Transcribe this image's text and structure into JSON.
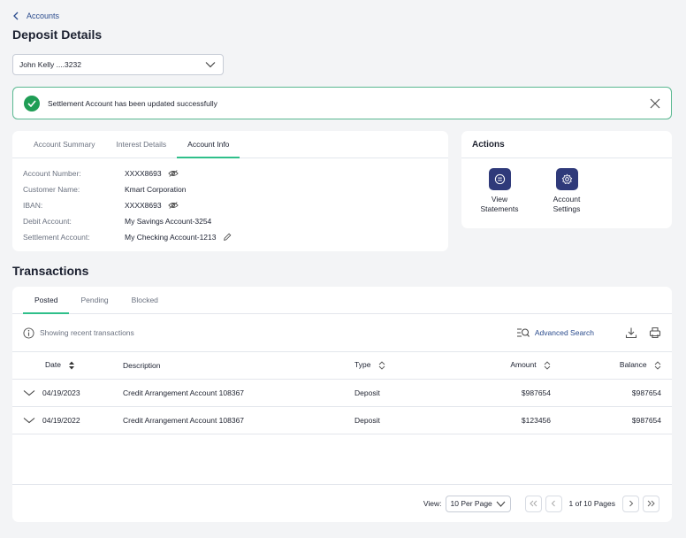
{
  "breadcrumb": "Accounts",
  "title": "Deposit Details",
  "account_select": "John Kelly ....3232",
  "alert": "Settlement Account has been updated successfully",
  "info_tabs": [
    "Account Summary",
    "Interest Details",
    "Account Info"
  ],
  "info_rows": [
    {
      "label": "Account Number:",
      "value": "XXXX8693"
    },
    {
      "label": "Customer Name:",
      "value": "Kmart Corporation"
    },
    {
      "label": "IBAN:",
      "value": "XXXX8693"
    },
    {
      "label": "Debit Account:",
      "value": "My Savings Account-3254"
    },
    {
      "label": "Settlement Account:",
      "value": "My Checking Account-1213"
    }
  ],
  "actions": {
    "title": "Actions",
    "view_statements": "View Statements",
    "account_settings": "Account Settings"
  },
  "transactions": {
    "title": "Transactions",
    "tabs": [
      "Posted",
      "Pending",
      "Blocked"
    ],
    "hint": "Showing recent transactions",
    "advanced_search": "Advanced Search",
    "columns": [
      "Date",
      "Description",
      "Type",
      "Amount",
      "Balance"
    ],
    "rows": [
      {
        "date": "04/19/2023",
        "description": "Credit Arrangement Account 108367",
        "type": "Deposit",
        "amount": "$987654",
        "balance": "$987654"
      },
      {
        "date": "04/19/2022",
        "description": "Credit Arrangement Account 108367",
        "type": "Deposit",
        "amount": "$123456",
        "balance": "$987654"
      }
    ],
    "view_label": "View:",
    "per_page": "10 Per Page",
    "page_label": "1 of 10 Pages"
  },
  "colors": {
    "accent": "#2fbf8a",
    "primary": "#2f3a7a",
    "link": "#2a4b8d",
    "success": "#1f9d55"
  }
}
